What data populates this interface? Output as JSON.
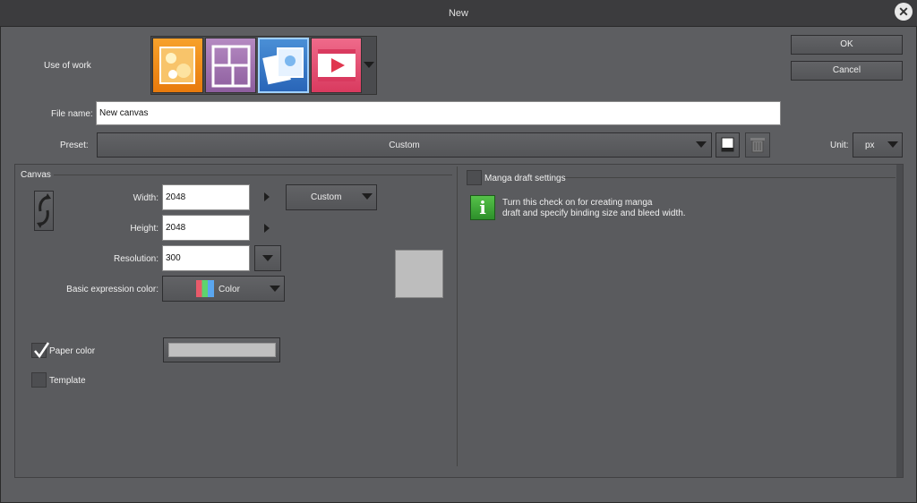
{
  "window": {
    "title": "New"
  },
  "buttons": {
    "ok": "OK",
    "cancel": "Cancel"
  },
  "use_of_work": {
    "label": "Use of work",
    "options": [
      "illustration-icon",
      "comic-icon",
      "all-purpose-icon",
      "animation-icon"
    ],
    "selected_index": 2
  },
  "file_name": {
    "label": "File name:",
    "value": "New canvas"
  },
  "preset": {
    "label": "Preset:",
    "value": "Custom"
  },
  "unit": {
    "label": "Unit:",
    "value": "px"
  },
  "canvas": {
    "group_title": "Canvas",
    "width_label": "Width:",
    "width_value": "2048",
    "height_label": "Height:",
    "height_value": "2048",
    "size_preset": "Custom",
    "resolution_label": "Resolution:",
    "resolution_value": "300",
    "color_label": "Basic expression color:",
    "color_value": "Color",
    "paper_color_label": "Paper color",
    "paper_color_checked": true,
    "paper_color": "#c0c0c0",
    "template_label": "Template",
    "template_checked": false
  },
  "manga": {
    "label": "Manga draft settings",
    "info_line1": "Turn this check on for creating manga",
    "info_line2": "draft and specify binding size and bleed width."
  }
}
